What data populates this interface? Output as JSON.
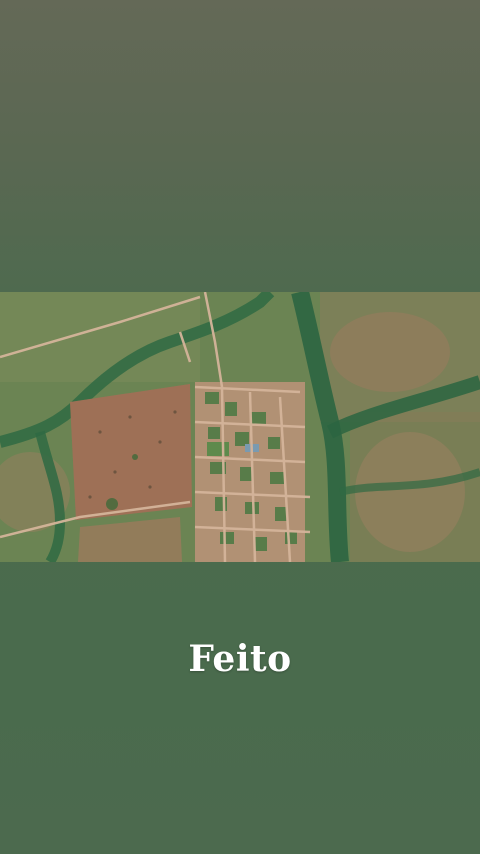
{
  "caption": {
    "text": "Feito"
  },
  "image": {
    "icon": "aerial-satellite-photo"
  },
  "colors": {
    "background_top": "#646957",
    "background_bottom": "#4a6b4d",
    "caption_text": "#ffffff",
    "vegetation": "#5b7a4d",
    "river": "#2f6a43",
    "bare_soil": "#a87a5c",
    "road": "#c9a58a"
  }
}
